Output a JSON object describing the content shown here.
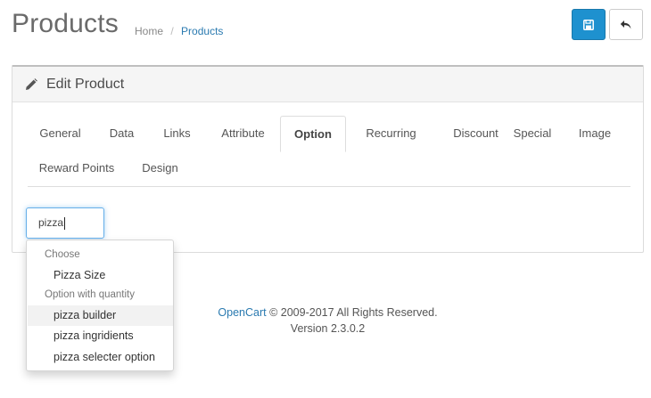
{
  "header": {
    "title": "Products",
    "breadcrumb": [
      "Home",
      "/",
      "Products"
    ]
  },
  "buttons": {
    "save_icon": "save-icon",
    "back_icon": "reply-icon"
  },
  "panel": {
    "title": "Edit Product",
    "icon": "pencil-icon"
  },
  "tabs": [
    {
      "label": "General"
    },
    {
      "label": "Data"
    },
    {
      "label": "Links"
    },
    {
      "label": "Attribute"
    },
    {
      "label": "Option",
      "active": true
    },
    {
      "label": "Recurring"
    },
    {
      "label": "Discount"
    },
    {
      "label": "Special"
    },
    {
      "label": "Image"
    },
    {
      "label": "Reward Points"
    },
    {
      "label": "Design"
    }
  ],
  "option_input": {
    "value": "pizza"
  },
  "dropdown": {
    "groups": [
      {
        "header": "Choose",
        "items": [
          "Pizza Size"
        ]
      },
      {
        "header": "Option with quantity",
        "items": [
          "pizza builder",
          "pizza ingridients",
          "pizza selecter option"
        ]
      }
    ]
  },
  "footer": {
    "link": "OpenCart",
    "copyright": " © 2009-2017 All Rights Reserved.",
    "version": "Version 2.3.0.2"
  },
  "colors": {
    "primary": "#1e91cf",
    "link": "#2a7ab0",
    "focus": "#66afe9"
  }
}
